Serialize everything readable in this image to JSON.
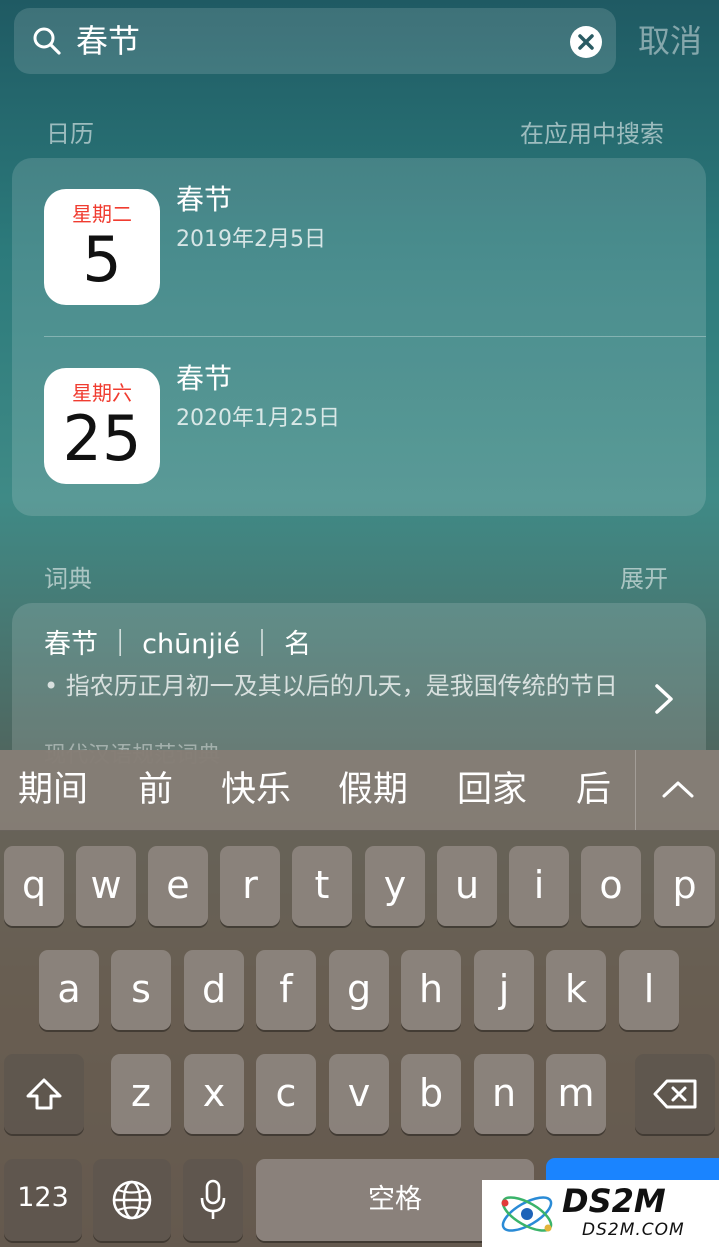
{
  "search": {
    "query": "春节",
    "cancel_label": "取消"
  },
  "calendar_section": {
    "title": "日历",
    "action": "在应用中搜索",
    "events": [
      {
        "weekday": "星期二",
        "day": "5",
        "title": "春节",
        "date": "2019年2月5日"
      },
      {
        "weekday": "星期六",
        "day": "25",
        "title": "春节",
        "date": "2020年1月25日"
      }
    ]
  },
  "dictionary_section": {
    "title": "词典",
    "action": "展开",
    "headword": "春节 ｜ chūnjié ｜ 名",
    "definition": "• 指农历正月初一及其以后的几天，是我国传统的节日",
    "faded_line": "现代汉语规范词典"
  },
  "keyboard": {
    "predictions": [
      "期间",
      "前",
      "快乐",
      "假期",
      "回家",
      "后"
    ],
    "row1": [
      "q",
      "w",
      "e",
      "r",
      "t",
      "y",
      "u",
      "i",
      "o",
      "p"
    ],
    "row2": [
      "a",
      "s",
      "d",
      "f",
      "g",
      "h",
      "j",
      "k",
      "l"
    ],
    "row3": [
      "z",
      "x",
      "c",
      "v",
      "b",
      "n",
      "m"
    ],
    "numbers_label": "123",
    "space_label": "空格",
    "return_color": "#1a84ff"
  },
  "watermark": {
    "brand": "DS2M",
    "domain": "DS2M.COM"
  },
  "icons": {
    "search": "search-icon",
    "clear": "clear-icon",
    "chevron": "chevron-right-icon",
    "expand": "chevron-up-icon",
    "shift": "shift-icon",
    "delete": "backspace-icon",
    "globe": "globe-icon",
    "mic": "microphone-icon"
  }
}
